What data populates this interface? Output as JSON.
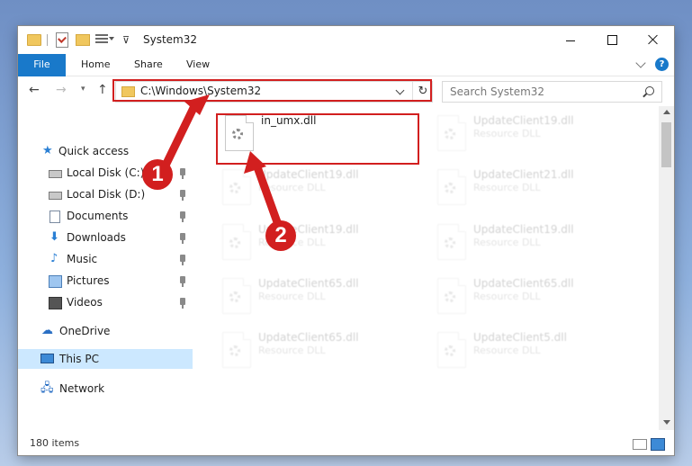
{
  "window": {
    "title": "System32",
    "file_tab": "File",
    "tabs": [
      "Home",
      "Share",
      "View"
    ],
    "help": "?"
  },
  "address": {
    "path": "C:\\Windows\\System32",
    "refresh": "↻"
  },
  "search": {
    "placeholder": "Search System32"
  },
  "nav": {
    "back": "←",
    "forward": "→",
    "recent": "▾",
    "up": "↑",
    "items": [
      {
        "label": "Quick access",
        "icon": "star-icon"
      },
      {
        "label": "Local Disk (C:)",
        "icon": "drive-icon",
        "pinned": true
      },
      {
        "label": "Local Disk (D:)",
        "icon": "drive-icon",
        "pinned": true
      },
      {
        "label": "Documents",
        "icon": "documents-icon",
        "pinned": true
      },
      {
        "label": "Downloads",
        "icon": "downloads-icon",
        "pinned": true
      },
      {
        "label": "Music",
        "icon": "music-icon",
        "pinned": true
      },
      {
        "label": "Pictures",
        "icon": "pictures-icon",
        "pinned": true
      },
      {
        "label": "Videos",
        "icon": "videos-icon",
        "pinned": true
      },
      {
        "label": "OneDrive",
        "icon": "cloud-icon"
      },
      {
        "label": "This PC",
        "icon": "computer-icon",
        "selected": true
      },
      {
        "label": "Network",
        "icon": "network-icon"
      }
    ]
  },
  "files": [
    {
      "name": "in_umx.dll",
      "type": ""
    },
    {
      "name": "UpdateClient19.dll",
      "type": "Resource DLL"
    },
    {
      "name": "UpdateClient19.dll",
      "type": "Resource DLL"
    },
    {
      "name": "UpdateClient21.dll",
      "type": "Resource DLL"
    },
    {
      "name": "UpdateClient19.dll",
      "type": "Resource DLL"
    },
    {
      "name": "UpdateClient19.dll",
      "type": "Resource DLL"
    },
    {
      "name": "UpdateClient65.dll",
      "type": "Resource DLL"
    },
    {
      "name": "UpdateClient65.dll",
      "type": "Resource DLL"
    },
    {
      "name": "UpdateClient65.dll",
      "type": "Resource DLL"
    },
    {
      "name": "UpdateClient5.dll",
      "type": "Resource DLL"
    }
  ],
  "annotations": {
    "step1": "1",
    "step2": "2",
    "color": "#d21f1f"
  },
  "status": {
    "count": "180 items"
  }
}
